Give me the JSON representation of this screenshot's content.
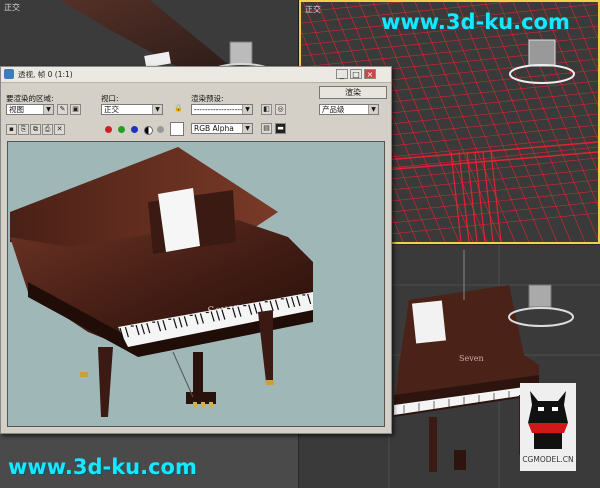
{
  "viewports": {
    "top_left": {
      "label": "正交"
    },
    "top_right": {
      "label": "正交"
    },
    "bottom_left": {
      "label": ""
    },
    "bottom_right": {
      "label": ""
    }
  },
  "watermarks": {
    "top": "www.3d-ku.com",
    "bottom": "www.3d-ku.com",
    "logo_text": "CGMODEL.CN"
  },
  "dialog": {
    "title": "透视, 帧 0 (1:1)",
    "area_label": "要渲染的区域:",
    "area_value": "视图",
    "viewport_label": "视口:",
    "viewport_value": "正交",
    "preset_label": "渲染预设:",
    "preset_value": "--------------------",
    "render_button": "渲染",
    "product_value": "产品级",
    "channel_value": "RGB Alpha",
    "piano_brand": "Seven"
  },
  "colors": {
    "accent_border": "#f0d24a",
    "wireframe": "#ff2030",
    "watermark": "#18e8ff",
    "render_bg": "#9fb7b6"
  }
}
